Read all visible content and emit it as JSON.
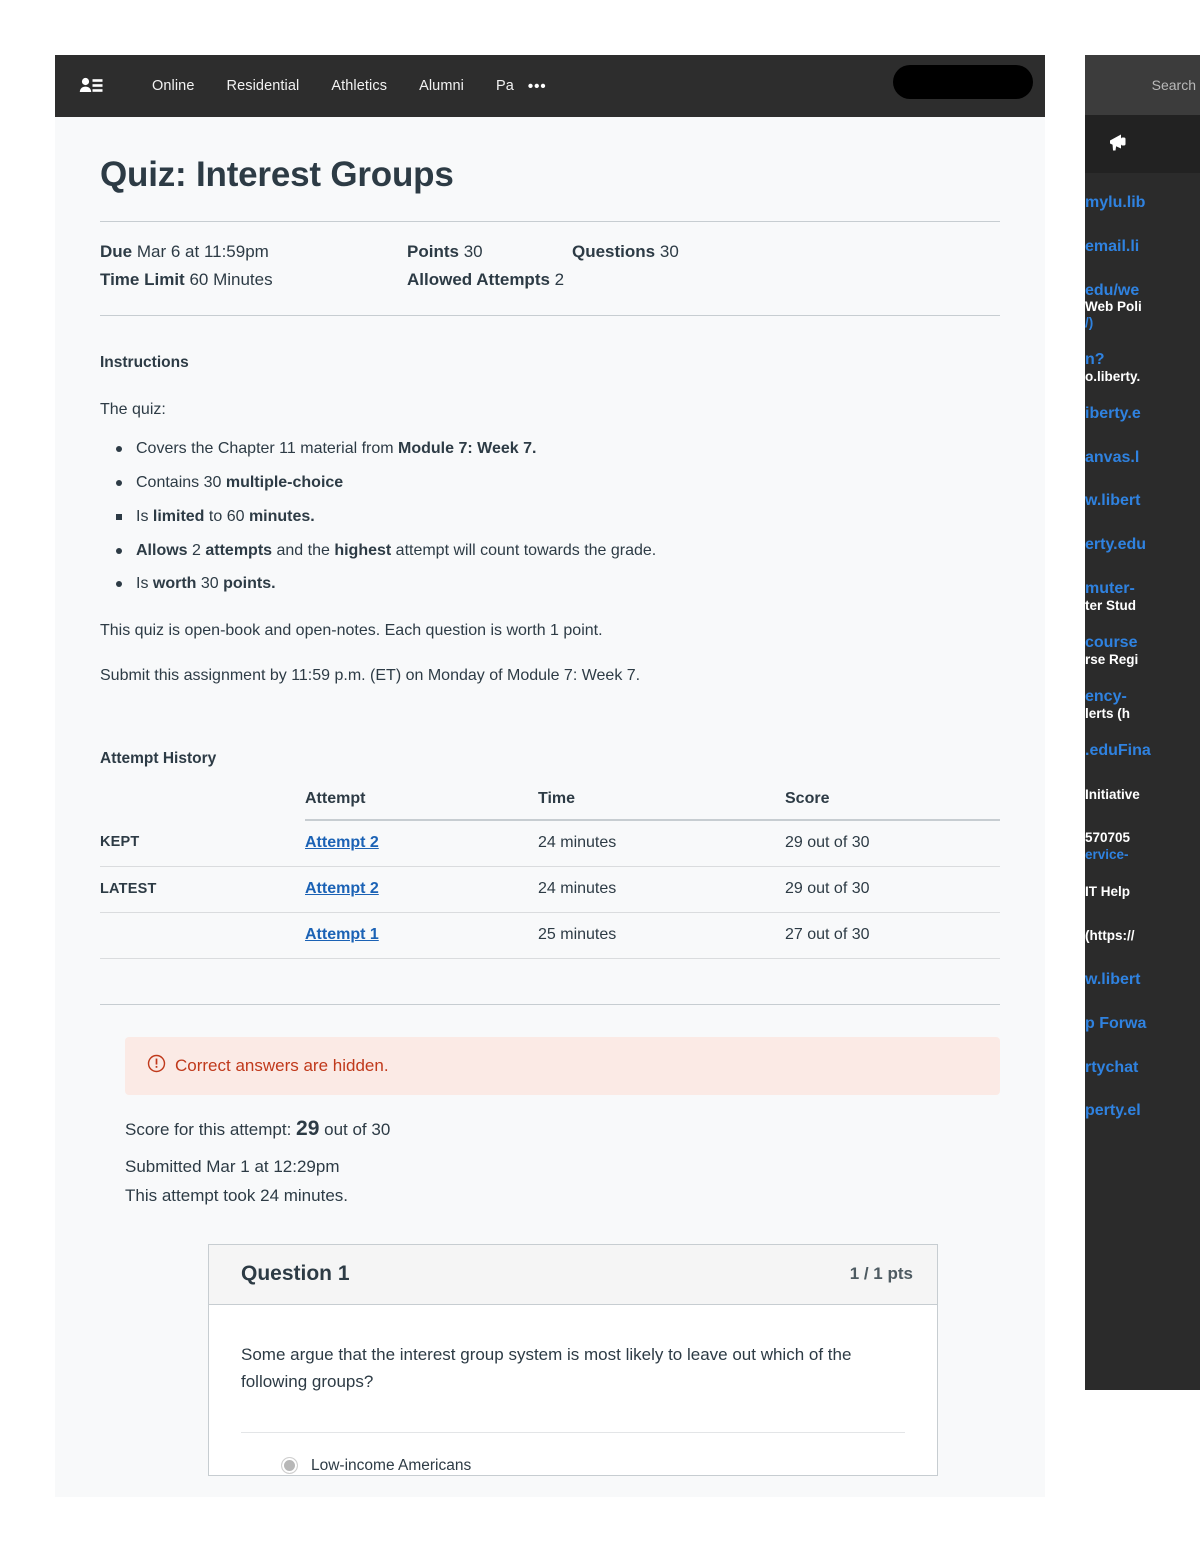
{
  "topnav": {
    "user_icon": "user-list-icon",
    "links": [
      "Online",
      "Residential",
      "Athletics",
      "Alumni",
      "Pa"
    ],
    "overflow": "•••",
    "redaction": ""
  },
  "quiz": {
    "title": "Quiz: Interest Groups",
    "meta": {
      "due_label": "Due",
      "due_value": "Mar 6 at 11:59pm",
      "points_label": "Points",
      "points_value": "30",
      "questions_label": "Questions",
      "questions_value": "30",
      "time_limit_label": "Time Limit",
      "time_limit_value": "60 Minutes",
      "allowed_attempts_label": "Allowed Attempts",
      "allowed_attempts_value": "2"
    }
  },
  "instructions": {
    "heading": "Instructions",
    "lead": "The quiz:",
    "bullets": [
      {
        "plain1": "Covers the Chapter 11 material from ",
        "bold1": "Module 7: Week 7.",
        "plain2": "",
        "bold2": "",
        "plain3": "",
        "square": false
      },
      {
        "plain1": "Contains 30 ",
        "bold1": "multiple-choice",
        "plain2": "",
        "bold2": "",
        "plain3": "",
        "square": false
      },
      {
        "plain1": "Is ",
        "bold1": "limited",
        "plain2": " to 60 ",
        "bold2": "minutes.",
        "plain3": "",
        "square": true
      },
      {
        "plain1": "",
        "bold1": "Allows",
        "plain2": " 2 ",
        "bold2": "attempts",
        "plain3": " and the ",
        "bold3": "highest",
        "plain4": " attempt will count towards the grade.",
        "square": false
      },
      {
        "plain1": "Is ",
        "bold1": "worth",
        "plain2": " 30 ",
        "bold2": "points.",
        "plain3": "",
        "square": false
      }
    ],
    "para1": "This quiz is open-book and open-notes.  Each question is worth 1 point.",
    "para2": "Submit this assignment by 11:59 p.m. (ET) on Monday of Module 7: Week 7."
  },
  "attempt_history": {
    "heading": "Attempt History",
    "columns": [
      "",
      "Attempt",
      "Time",
      "Score"
    ],
    "rows": [
      {
        "label": "KEPT",
        "attempt": "Attempt 2",
        "time": "24 minutes",
        "score": "29 out of 30"
      },
      {
        "label": "LATEST",
        "attempt": "Attempt 2",
        "time": "24 minutes",
        "score": "29 out of 30"
      },
      {
        "label": "",
        "attempt": "Attempt 1",
        "time": "25 minutes",
        "score": "27 out of 30"
      }
    ]
  },
  "result": {
    "hidden_banner": "Correct answers are hidden.",
    "warn_icon": "exclamation-circle-icon",
    "score_prefix": "Score for this attempt:",
    "score_value": "29",
    "score_suffix": "out of 30",
    "submitted": "Submitted Mar 1 at 12:29pm",
    "duration": "This attempt took 24 minutes."
  },
  "question": {
    "title": "Question 1",
    "points": "1 / 1 pts",
    "text": "Some argue that the interest group system is most likely to leave out which of the following groups?",
    "answers": [
      {
        "text": "Low-income Americans",
        "selected": true
      }
    ]
  },
  "right_panel": {
    "search_placeholder": "Search",
    "announcement_icon": "megaphone-icon",
    "items": [
      {
        "link": "mylu.lib",
        "sub": "",
        "sub_link": ""
      },
      {
        "link": "email.li",
        "sub": "",
        "sub_link": ""
      },
      {
        "link": "edu/we",
        "sub": "Web Poli",
        "sub_link": "/)"
      },
      {
        "link": "n?",
        "sub": "o.liberty.",
        "sub_link": ""
      },
      {
        "link": "iberty.e",
        "sub": "",
        "sub_link": ""
      },
      {
        "link": "anvas.l",
        "sub": "",
        "sub_link": ""
      },
      {
        "link": "w.libert",
        "sub": "",
        "sub_link": ""
      },
      {
        "link": "erty.edu",
        "sub": "",
        "sub_link": ""
      },
      {
        "link": "muter-",
        "sub": "ter Stud",
        "sub_link": ""
      },
      {
        "link": "course",
        "sub": "rse Regi",
        "sub_link": ""
      },
      {
        "link": "ency-",
        "sub": "lerts (h",
        "sub_link": ""
      },
      {
        "link": ".eduFina",
        "sub": "",
        "sub_link": ""
      },
      {
        "link": "",
        "sub": "Initiative",
        "sub_link": ""
      },
      {
        "link": "",
        "sub": "570705",
        "sub_link": "ervice-"
      },
      {
        "link": "",
        "sub": "IT Help",
        "sub_link": ""
      },
      {
        "link": "",
        "sub": "(https://",
        "sub_link": ""
      },
      {
        "link": "w.libert",
        "sub": "",
        "sub_link": ""
      },
      {
        "link": "p Forwa",
        "sub": "",
        "sub_link": ""
      },
      {
        "link": "rtychat",
        "sub": "",
        "sub_link": ""
      },
      {
        "link": "perty.el",
        "sub": "",
        "sub_link": ""
      }
    ]
  },
  "colors": {
    "nav_bg": "#2d2d2d",
    "page_bg": "#f8f9fa",
    "text": "#2d3b45",
    "link": "#1b62b5",
    "warn_text": "#c0391b",
    "warn_bg": "#fbeae5",
    "panel_bg": "#2b2b2b",
    "panel_link": "#2f82e0"
  }
}
